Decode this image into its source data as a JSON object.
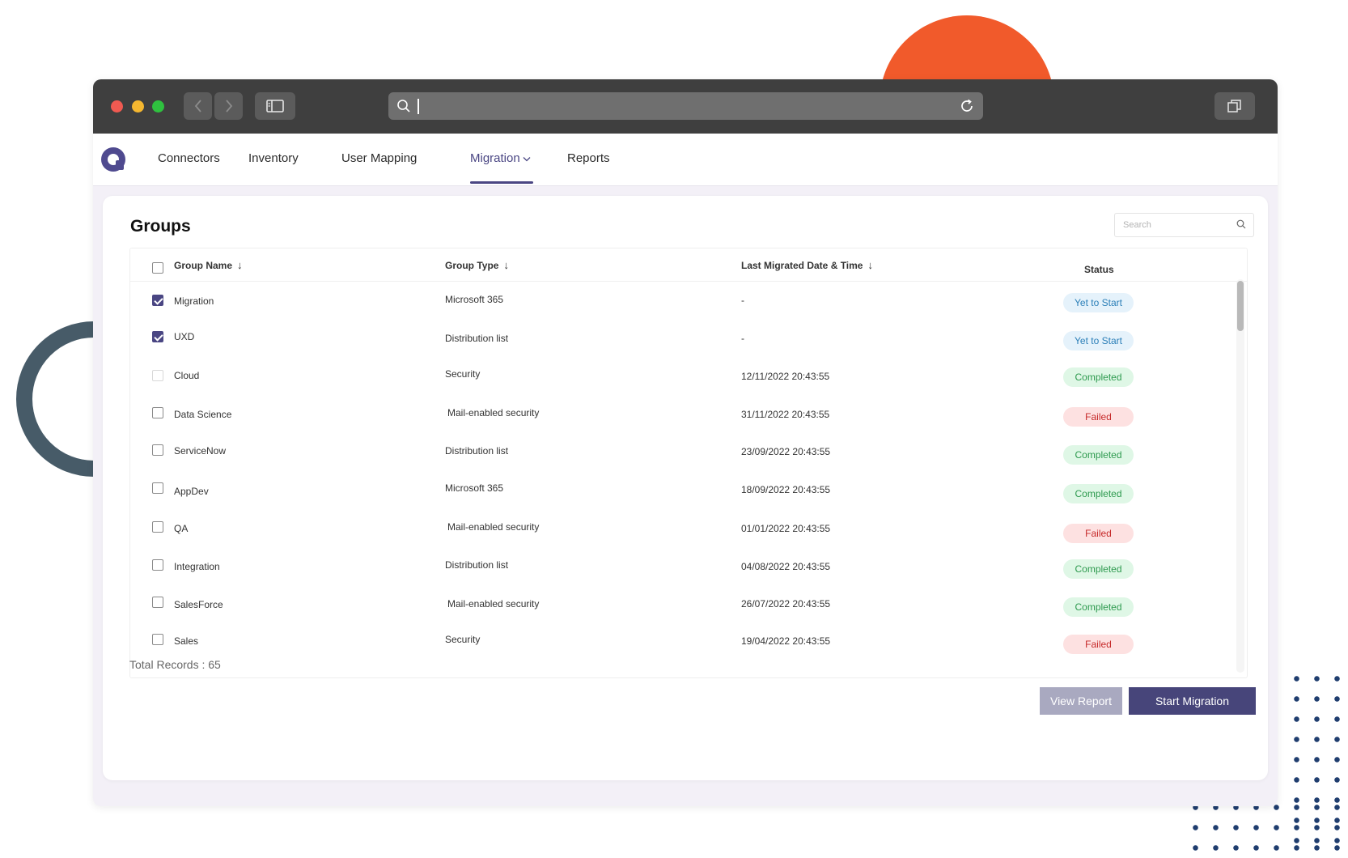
{
  "colors": {
    "accent": "#4a4683",
    "decor_orange": "#f15a2b",
    "decor_ring": "#475b68",
    "status_blue": "#2b7fb8",
    "status_green": "#2e9a4f",
    "status_red": "#c62a2a"
  },
  "browser": {
    "icons": [
      "back-icon",
      "forward-icon",
      "sidebar-icon",
      "search-icon",
      "reload-icon",
      "windows-icon"
    ],
    "url_value": ""
  },
  "nav": {
    "items": [
      {
        "label": "Connectors"
      },
      {
        "label": "Inventory"
      },
      {
        "label": "User Mapping"
      },
      {
        "label": "Migration",
        "active": true
      },
      {
        "label": "Reports"
      }
    ]
  },
  "groups": {
    "title": "Groups",
    "search_placeholder": "Search",
    "search_value": "",
    "columns": {
      "name": "Group Name",
      "type": "Group Type",
      "date": "Last Migrated Date & Time",
      "status": "Status"
    },
    "rows": [
      {
        "name": "Migration",
        "type": "Microsoft 365",
        "date": "-",
        "status": "Yet to Start",
        "checked": true
      },
      {
        "name": "UXD",
        "type": "Distribution list",
        "date": "-",
        "status": "Yet to Start",
        "checked": true
      },
      {
        "name": "Cloud",
        "type": "Security",
        "date": "12/11/2022 20:43:55",
        "status": "Completed",
        "checked": false
      },
      {
        "name": "Data Science",
        "type": "Mail-enabled security",
        "date": "31/11/2022 20:43:55",
        "status": "Failed",
        "checked": false
      },
      {
        "name": "ServiceNow",
        "type": "Distribution list",
        "date": "23/09/2022 20:43:55",
        "status": "Completed",
        "checked": false
      },
      {
        "name": "AppDev",
        "type": "Microsoft 365",
        "date": "18/09/2022 20:43:55",
        "status": "Completed",
        "checked": false
      },
      {
        "name": "QA",
        "type": "Mail-enabled security",
        "date": "01/01/2022 20:43:55",
        "status": "Failed",
        "checked": false
      },
      {
        "name": "Integration",
        "type": "Distribution list",
        "date": "04/08/2022 20:43:55",
        "status": "Completed",
        "checked": false
      },
      {
        "name": "SalesForce",
        "type": "Mail-enabled security",
        "date": "26/07/2022 20:43:55",
        "status": "Completed",
        "checked": false
      },
      {
        "name": "Sales",
        "type": "Security",
        "date": "19/04/2022 20:43:55",
        "status": "Failed",
        "checked": false
      }
    ],
    "total_records": "Total Records : 65"
  },
  "actions": {
    "view_report": "View Report",
    "start_migration": "Start Migration"
  }
}
